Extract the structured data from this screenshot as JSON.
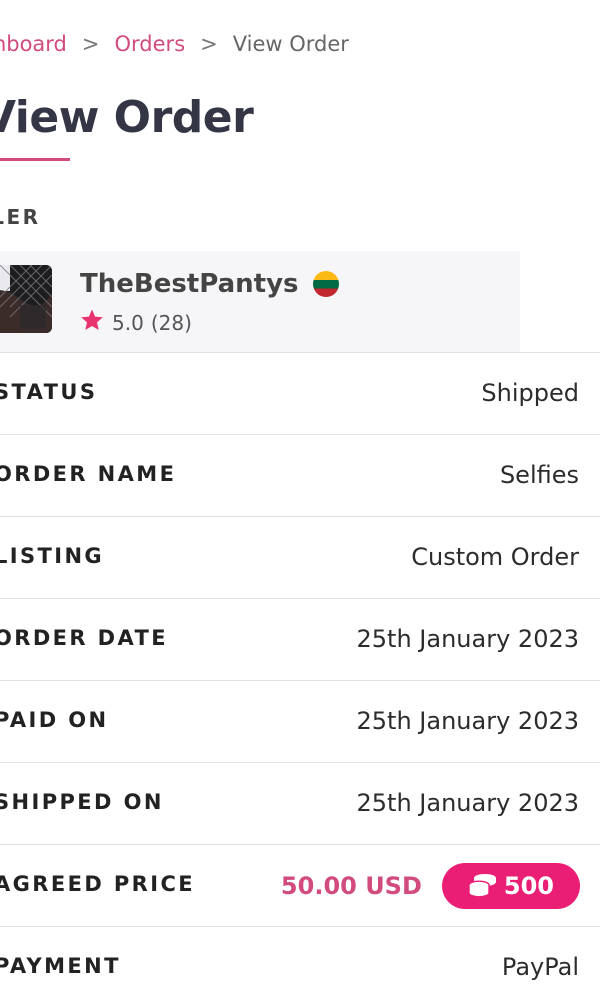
{
  "breadcrumb": {
    "items": [
      {
        "label": "shboard"
      },
      {
        "label": "Orders"
      }
    ],
    "separator": ">",
    "current": "View Order"
  },
  "title": "View Order",
  "seller": {
    "label": "LLER",
    "name": "TheBestPantys",
    "flag_icon": "lithuania-flag-icon",
    "rating": "5.0",
    "rating_count": "(28)"
  },
  "details": [
    {
      "label": "STATUS",
      "value": "Shipped"
    },
    {
      "label": "ORDER NAME",
      "value": "Selfies"
    },
    {
      "label": "LISTING",
      "value": "Custom Order"
    },
    {
      "label": "ORDER DATE",
      "value": "25th January 2023"
    },
    {
      "label": "PAID ON",
      "value": "25th January 2023"
    },
    {
      "label": "SHIPPED ON",
      "value": "25th January 2023"
    },
    {
      "label": "AGREED PRICE",
      "value": "50.00 USD",
      "coins": "500"
    },
    {
      "label": "PAYMENT",
      "value": "PayPal"
    }
  ],
  "colors": {
    "accent": "#d24b7e",
    "coin_pill": "#ea1e74",
    "title": "#343646"
  }
}
